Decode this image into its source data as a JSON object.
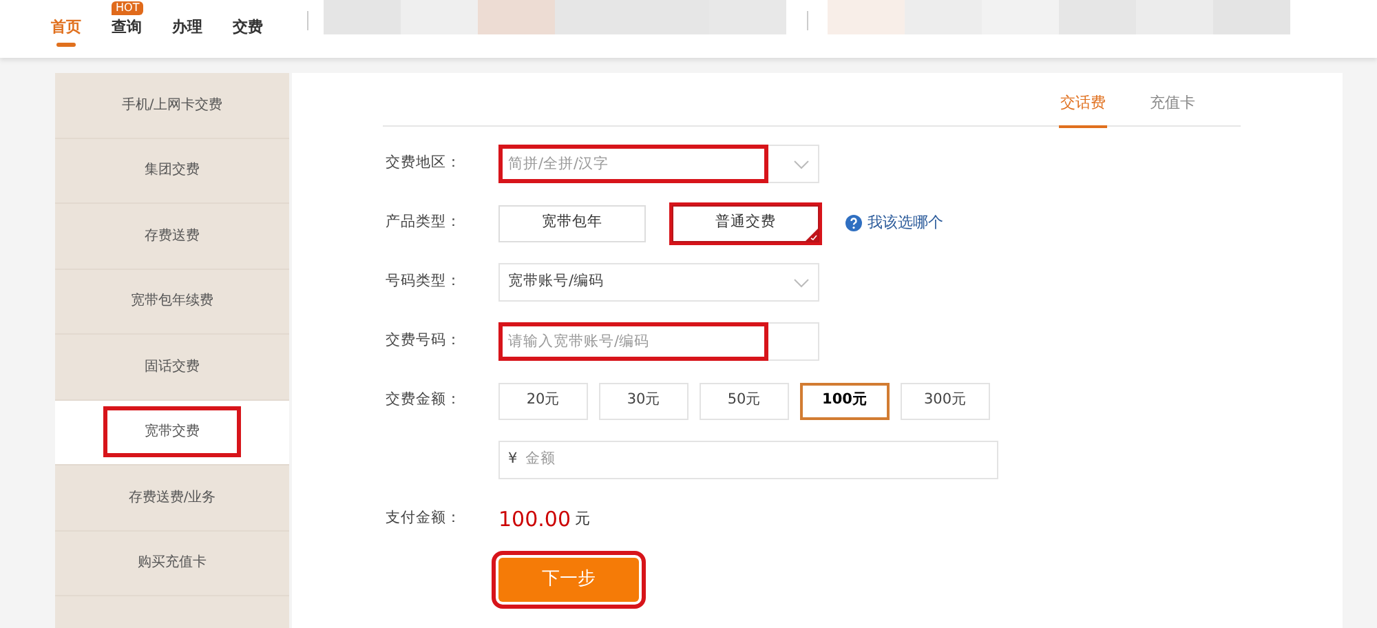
{
  "top_nav": [
    {
      "label": "首页",
      "selected": true
    },
    {
      "label": "查询",
      "selected": false,
      "badge": "HOT"
    },
    {
      "label": "办理",
      "selected": false
    },
    {
      "label": "交费",
      "selected": false
    }
  ],
  "sidebar": {
    "items": [
      {
        "label": "手机/上网卡交费",
        "selected": false,
        "highlighted": false
      },
      {
        "label": "集团交费",
        "selected": false,
        "highlighted": false
      },
      {
        "label": "存费送费",
        "selected": false,
        "highlighted": false
      },
      {
        "label": "宽带包年续费",
        "selected": false,
        "highlighted": false
      },
      {
        "label": "固话交费",
        "selected": false,
        "highlighted": false
      },
      {
        "label": "宽带交费",
        "selected": true,
        "highlighted": true
      },
      {
        "label": "存费送费/业务",
        "selected": false,
        "highlighted": false
      },
      {
        "label": "购买充值卡",
        "selected": false,
        "highlighted": false
      }
    ]
  },
  "tabs": [
    {
      "label": "交话费",
      "selected": true
    },
    {
      "label": "充值卡",
      "selected": false
    }
  ],
  "form": {
    "region": {
      "label": "交费地区：",
      "placeholder": "简拼/全拼/汉字",
      "highlighted": true
    },
    "product_type": {
      "label": "产品类型：",
      "options": [
        {
          "label": "宽带包年",
          "selected": false,
          "highlighted": false
        },
        {
          "label": "普通交费",
          "selected": true,
          "highlighted": true
        }
      ],
      "help": "我该选哪个"
    },
    "number_type": {
      "label": "号码类型：",
      "value": "宽带账号/编码"
    },
    "number": {
      "label": "交费号码：",
      "placeholder": "请输入宽带账号/编码",
      "highlighted": true
    },
    "amount": {
      "label": "交费金额：",
      "options": [
        {
          "label": "20元",
          "selected": false
        },
        {
          "label": "30元",
          "selected": false
        },
        {
          "label": "50元",
          "selected": false
        },
        {
          "label": "100元",
          "selected": true
        },
        {
          "label": "300元",
          "selected": false
        }
      ],
      "currency": "¥",
      "placeholder": "金额"
    },
    "pay": {
      "label": "支付金额：",
      "value": "100.00",
      "unit": "元"
    },
    "next_button": {
      "label": "下一步",
      "highlighted": true
    }
  }
}
